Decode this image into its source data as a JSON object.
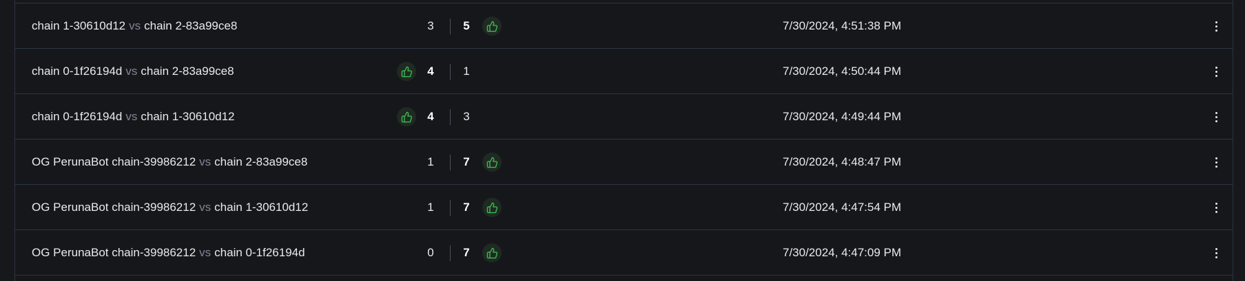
{
  "vs_label": "vs",
  "accent_color": "#3fb950",
  "rows": [
    {
      "a": "chain 1-30610d12",
      "b": "chain 2-83a99ce8",
      "score_a": "3",
      "score_b": "5",
      "winner": "b",
      "time": "7/30/2024, 4:51:38 PM"
    },
    {
      "a": "chain 0-1f26194d",
      "b": "chain 2-83a99ce8",
      "score_a": "4",
      "score_b": "1",
      "winner": "a",
      "time": "7/30/2024, 4:50:44 PM"
    },
    {
      "a": "chain 0-1f26194d",
      "b": "chain 1-30610d12",
      "score_a": "4",
      "score_b": "3",
      "winner": "a",
      "time": "7/30/2024, 4:49:44 PM"
    },
    {
      "a": "OG PerunaBot chain-39986212",
      "b": "chain 2-83a99ce8",
      "score_a": "1",
      "score_b": "7",
      "winner": "b",
      "time": "7/30/2024, 4:48:47 PM"
    },
    {
      "a": "OG PerunaBot chain-39986212",
      "b": "chain 1-30610d12",
      "score_a": "1",
      "score_b": "7",
      "winner": "b",
      "time": "7/30/2024, 4:47:54 PM"
    },
    {
      "a": "OG PerunaBot chain-39986212",
      "b": "chain 0-1f26194d",
      "score_a": "0",
      "score_b": "7",
      "winner": "b",
      "time": "7/30/2024, 4:47:09 PM"
    }
  ],
  "row_menu_icon": "kebab-menu-icon",
  "winner_icon": "thumbs-up-icon"
}
